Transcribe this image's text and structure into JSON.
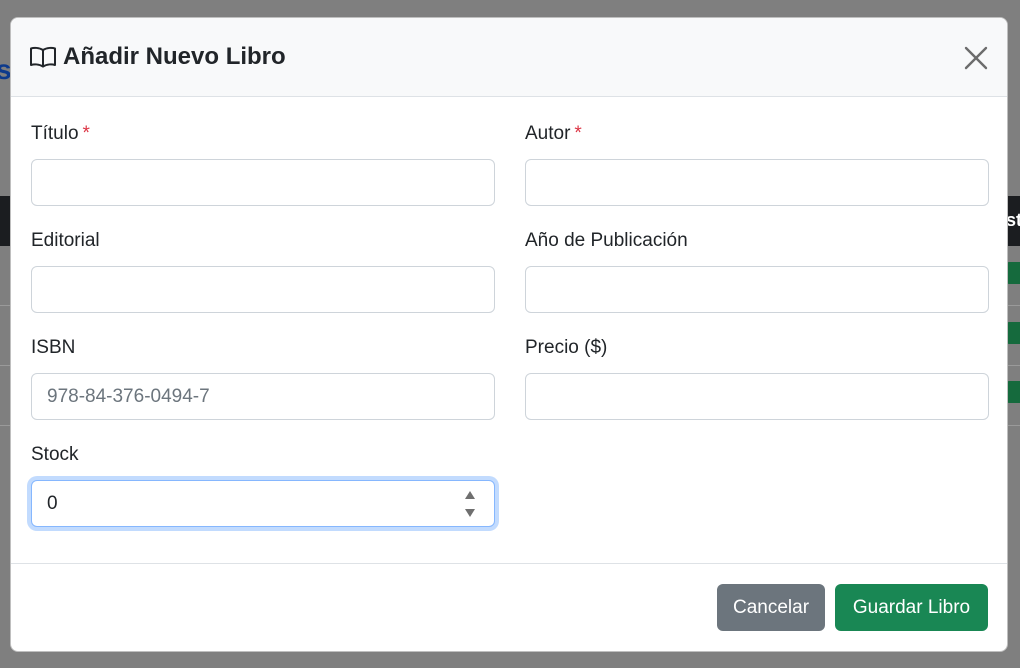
{
  "background": {
    "left_letter": "s",
    "right_header": "st"
  },
  "modal": {
    "title": "Añadir Nuevo Libro",
    "icon": "book-open-icon",
    "close_icon": "close-icon"
  },
  "form": {
    "titulo": {
      "label": "Título",
      "required_mark": "*",
      "value": "",
      "placeholder": ""
    },
    "autor": {
      "label": "Autor",
      "required_mark": "*",
      "value": "",
      "placeholder": ""
    },
    "editorial": {
      "label": "Editorial",
      "value": "",
      "placeholder": ""
    },
    "anio": {
      "label": "Año de Publicación",
      "value": "",
      "placeholder": ""
    },
    "isbn": {
      "label": "ISBN",
      "value": "",
      "placeholder": "978-84-376-0494-7"
    },
    "precio": {
      "label": "Precio ($)",
      "value": "",
      "placeholder": ""
    },
    "stock": {
      "label": "Stock",
      "value": "0"
    }
  },
  "footer": {
    "cancel_label": "Cancelar",
    "save_label": "Guardar Libro"
  },
  "colors": {
    "required": "#dc3545",
    "cancel": "#6c757d",
    "save": "#198754",
    "focus": "#86b7fe"
  }
}
